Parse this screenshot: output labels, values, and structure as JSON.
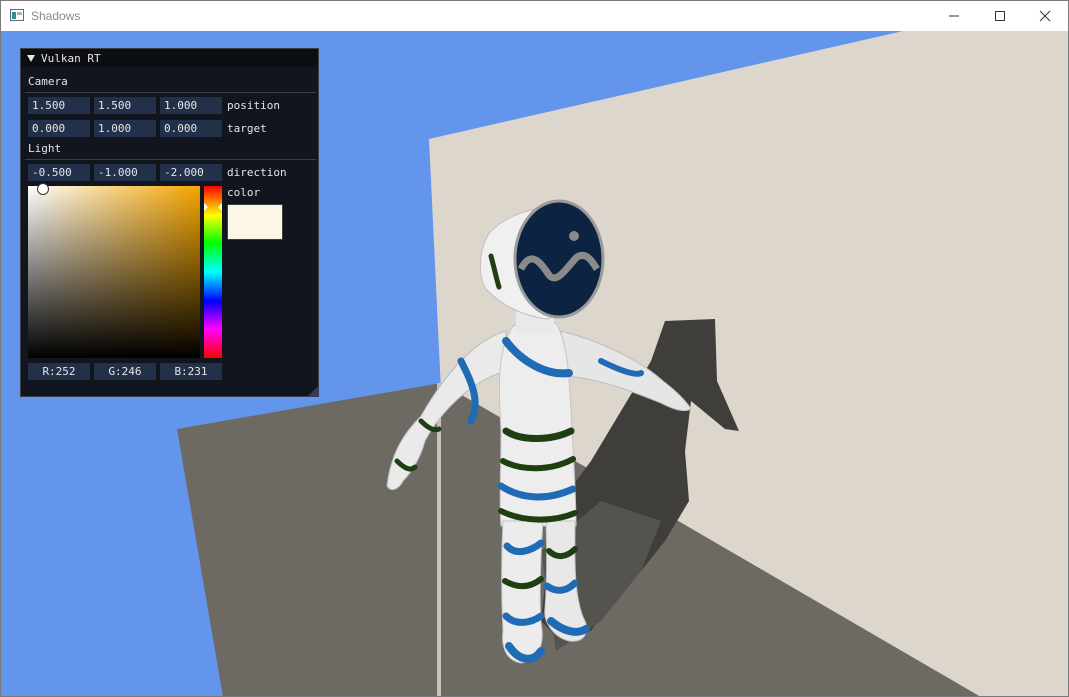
{
  "window": {
    "title": "Shadows",
    "controls": [
      "minimize",
      "maximize",
      "close"
    ]
  },
  "panel": {
    "title": "Vulkan RT",
    "camera": {
      "header": "Camera",
      "position": [
        "1.500",
        "1.500",
        "1.000"
      ],
      "position_label": "position",
      "target": [
        "0.000",
        "1.000",
        "0.000"
      ],
      "target_label": "target"
    },
    "light": {
      "header": "Light",
      "direction": [
        "-0.500",
        "-1.000",
        "-2.000"
      ],
      "direction_label": "direction",
      "color_label": "color",
      "rgb": [
        "R:252",
        "G:246",
        "B:231"
      ],
      "color_hex": "#fcf6e7"
    }
  },
  "scene": {
    "background": "#6495ed",
    "wall": "#dcd6cc",
    "floor": "#6e6b65",
    "shadow": "#3e3d3a",
    "character_body": "#eeeeee",
    "stripe_blue": "#1f6bb5",
    "stripe_green": "#1f3f12",
    "visor": "#0d2440"
  }
}
